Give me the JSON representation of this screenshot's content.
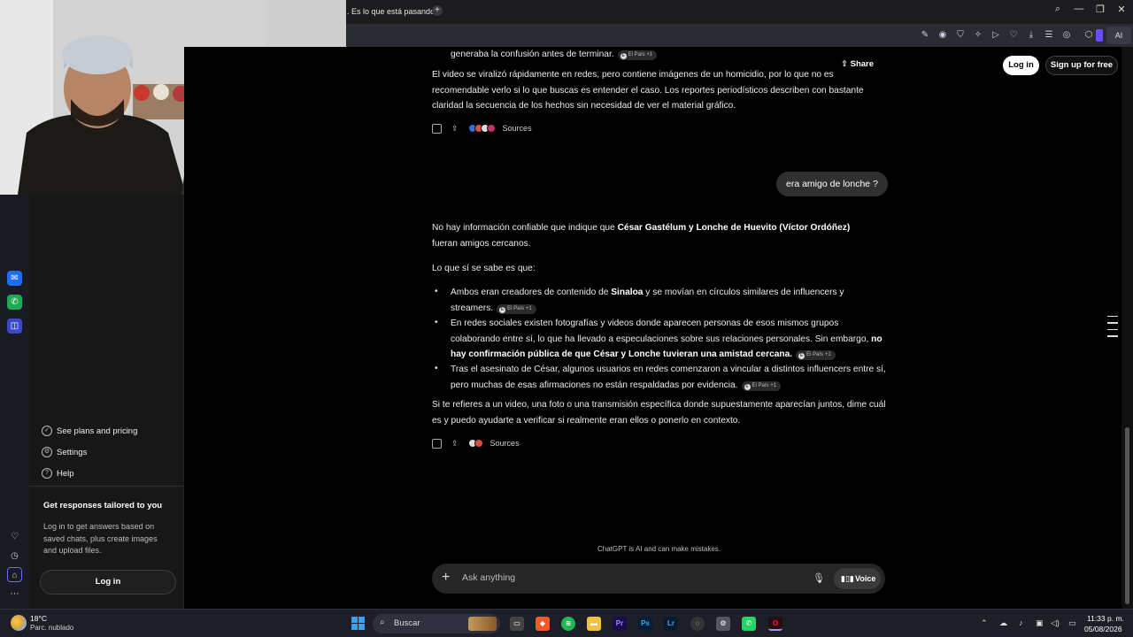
{
  "browser": {
    "tab_title": ". Es lo que está pasando",
    "new_tab": "+",
    "ai_label": "AI"
  },
  "header": {
    "share": "Share",
    "login": "Log in",
    "signup": "Sign up for free"
  },
  "chat": {
    "msg1_tail": "generaba la confusión antes de terminar.",
    "msg1_p2": "El video se viralizó rápidamente en redes, pero contiene imágenes de un homicidio, por lo que no es recomendable verlo si lo que buscas es entender el caso. Los reportes periodísticos describen con bastante claridad la secuencia de los hechos sin necesidad de ver el material gráfico.",
    "sources_label": "Sources",
    "user_message": "era amigo de lonche ?",
    "r_p1_a": "No hay información confiable que indique que ",
    "r_p1_b": "César Gastélum y Lonche de Huevito (Víctor Ordóñez)",
    "r_p1_c": "fueran amigos cercanos.",
    "r_p2": "Lo que sí se sabe es que:",
    "b1_a": "Ambos eran creadores de contenido de ",
    "b1_b": "Sinaloa",
    "b1_c": " y se movían en círculos similares de influencers y streamers.",
    "b2_a": "En redes sociales existen fotografías y videos donde aparecen personas de esos mismos grupos colaborando entre sí, lo que ha llevado a especulaciones sobre sus relaciones personales. Sin embargo, ",
    "b2_b": "no hay confirmación pública de que César y Lonche tuvieran una amistad cercana.",
    "b3": "Tras el asesinato de César, algunos usuarios en redes comenzaron a vincular a distintos influencers entre sí, pero muchas de esas afirmaciones no están respaldadas por evidencia.",
    "r_p3": "Si te refieres a un video, una foto o una transmisión específica donde supuestamente aparecían juntos, dime cuál es y puedo ayudarte a verificar si realmente eran ellos o ponerlo en contexto.",
    "citation": "El País",
    "citation_more": "+1"
  },
  "sidebar": {
    "plans": "See plans and pricing",
    "settings": "Settings",
    "help": "Help",
    "tailored_title": "Get responses tailored to you",
    "tailored_body": "Log in to get answers based on saved chats, plus create images and upload files.",
    "login": "Log in"
  },
  "composer": {
    "placeholder": "Ask anything",
    "voice": "Voice",
    "disclaimer": "ChatGPT is AI and can make mistakes."
  },
  "taskbar": {
    "temp": "18°C",
    "weather": "Parc. nublado",
    "search": "Buscar",
    "time": "11:33 p. m.",
    "date": "05/08/2026"
  },
  "colors": {
    "accent": "#6a4cff",
    "bubble": "#303030",
    "background": "#000000"
  }
}
